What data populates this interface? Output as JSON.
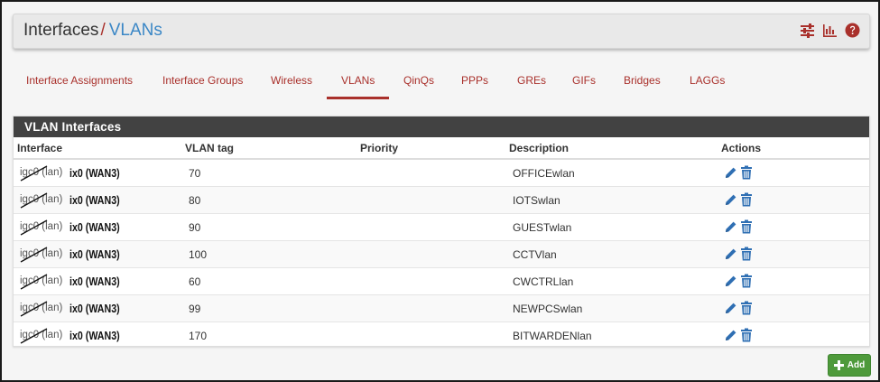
{
  "breadcrumb": {
    "parent": "Interfaces",
    "separator": "/",
    "current": "VLANs"
  },
  "header_icons": [
    "sliders-icon",
    "bar-chart-icon",
    "help-icon"
  ],
  "tabs": [
    {
      "label": "Interface Assignments",
      "active": false
    },
    {
      "label": "Interface Groups",
      "active": false
    },
    {
      "label": "Wireless",
      "active": false
    },
    {
      "label": "VLANs",
      "active": true
    },
    {
      "label": "QinQs",
      "active": false
    },
    {
      "label": "PPPs",
      "active": false
    },
    {
      "label": "GREs",
      "active": false
    },
    {
      "label": "GIFs",
      "active": false
    },
    {
      "label": "Bridges",
      "active": false
    },
    {
      "label": "LAGGs",
      "active": false
    }
  ],
  "panel": {
    "title": "VLAN Interfaces",
    "columns": [
      "Interface",
      "VLAN tag",
      "Priority",
      "Description",
      "Actions"
    ],
    "rows": [
      {
        "iface_old": "igc0 (lan)",
        "iface_new": "ix0 (WAN3)",
        "tag": "70",
        "priority": "",
        "description": "OFFICEwlan"
      },
      {
        "iface_old": "igc0 (lan)",
        "iface_new": "ix0 (WAN3)",
        "tag": "80",
        "priority": "",
        "description": "IOTSwlan"
      },
      {
        "iface_old": "igc0 (lan)",
        "iface_new": "ix0 (WAN3)",
        "tag": "90",
        "priority": "",
        "description": "GUESTwlan"
      },
      {
        "iface_old": "igc0 (lan)",
        "iface_new": "ix0 (WAN3)",
        "tag": "100",
        "priority": "",
        "description": "CCTVlan"
      },
      {
        "iface_old": "igc0 (lan)",
        "iface_new": "ix0 (WAN3)",
        "tag": "60",
        "priority": "",
        "description": "CWCTRLlan"
      },
      {
        "iface_old": "igc0 (lan)",
        "iface_new": "ix0 (WAN3)",
        "tag": "99",
        "priority": "",
        "description": "NEWPCSwlan"
      },
      {
        "iface_old": "igc0 (lan)",
        "iface_new": "ix0 (WAN3)",
        "tag": "170",
        "priority": "",
        "description": "BITWARDENlan"
      }
    ],
    "row_actions": [
      "edit-icon",
      "delete-icon"
    ]
  },
  "add_button": {
    "label": "Add",
    "icon": "plus-icon"
  },
  "colors": {
    "accent": "#a9302b",
    "link_blue": "#3b87c6",
    "panel_head": "#424242",
    "add_green": "#4e9a3b",
    "action_blue": "#2f6fb3"
  }
}
